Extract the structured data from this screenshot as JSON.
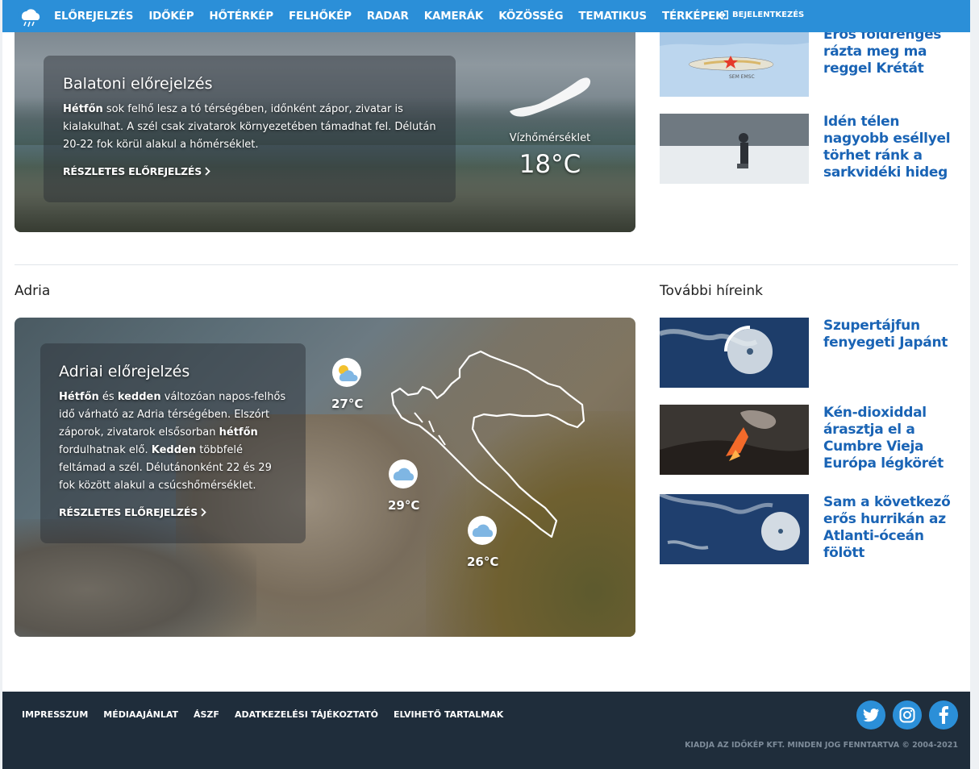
{
  "nav": {
    "items": [
      "ELŐREJELZÉS",
      "IDŐKÉP",
      "HŐTÉRKÉP",
      "FELHŐKÉP",
      "RADAR",
      "KAMERÁK",
      "KÖZÖSSÉG",
      "TEMATIKUS",
      "TÉRKÉPEK"
    ],
    "login": "BEJELENTKEZÉS"
  },
  "balaton": {
    "title": "Balatoni előrejelzés",
    "text_bold": "Hétfőn",
    "text_rest": " sok felhő lesz a tó térségében, időnként zápor, zivatar is kialakulhat. A szél csak zivatarok környezetében támadhat fel. Délután 20-22 fok körül alakul a hőmérséklet.",
    "link": "RÉSZLETES ELŐREJELZÉS",
    "water_label": "Vízhőmérséklet",
    "water_temp": "18°C"
  },
  "news_top": [
    {
      "title": "Erős földrengés rázta meg ma reggel Krétát",
      "thumb_overlay": "SEM EMSC"
    },
    {
      "title": "Idén télen nagyobb eséllyel törhet ránk a sarkvidéki hideg"
    }
  ],
  "adria": {
    "section_label": "Adria",
    "title": "Adriai előrejelzés",
    "p1_b1": "Hétfőn",
    "p1_t1": " és ",
    "p1_b2": "kedden",
    "p1_t2": " változóan napos-felhős idő várható az Adria térségében. Elszórt záporok, zivatarok elsősorban ",
    "p1_b3": "hétfőn",
    "p1_t3": " fordulhatnak elő. ",
    "p1_b4": "Kedden",
    "p1_t4": " többfelé feltámad a szél. Délutánonként 22 és 29 fok között alakul a csúcshőmérséklet.",
    "link": "RÉSZLETES ELŐREJELZÉS",
    "temps": [
      "27°C",
      "29°C",
      "26°C"
    ]
  },
  "news_more": {
    "section_label": "További híreink",
    "items": [
      {
        "title": "Szupertájfun fenyegeti Japánt"
      },
      {
        "title": "Kén-dioxiddal árasztja el a Cumbre Vieja Európa légkörét"
      },
      {
        "title": "Sam a következő erős hurrikán az Atlanti-óceán fölött"
      }
    ]
  },
  "footer": {
    "links": [
      "IMPRESSZUM",
      "MÉDIAAJÁNLAT",
      "ÁSZF",
      "ADATKEZELÉSI TÁJÉKOZTATÓ",
      "ELVIHETŐ TARTALMAK"
    ],
    "copyright": "KIADJA AZ IDŐKÉP KFT. MINDEN JOG FENNTARTVA © 2004-2021"
  },
  "colors": {
    "nav": "#2b8fd8",
    "link": "#1a64b5",
    "footer": "#1f2d3b"
  }
}
